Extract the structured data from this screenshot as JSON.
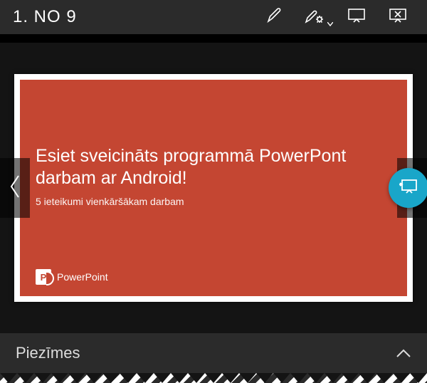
{
  "toolbar": {
    "slide_counter": "1. NO 9"
  },
  "slide": {
    "title": "Esiet sveicināts programmā PowerPont darbam ar Android!",
    "subtitle": "5 ieteikumi vienkāršākam darbam",
    "brand": "PowerPoint",
    "brand_letter": "P"
  },
  "notes": {
    "label": "Piezīmes"
  },
  "colors": {
    "slide_bg": "#c44632",
    "fab": "#19a6c9",
    "chrome": "#2b2b2b"
  }
}
